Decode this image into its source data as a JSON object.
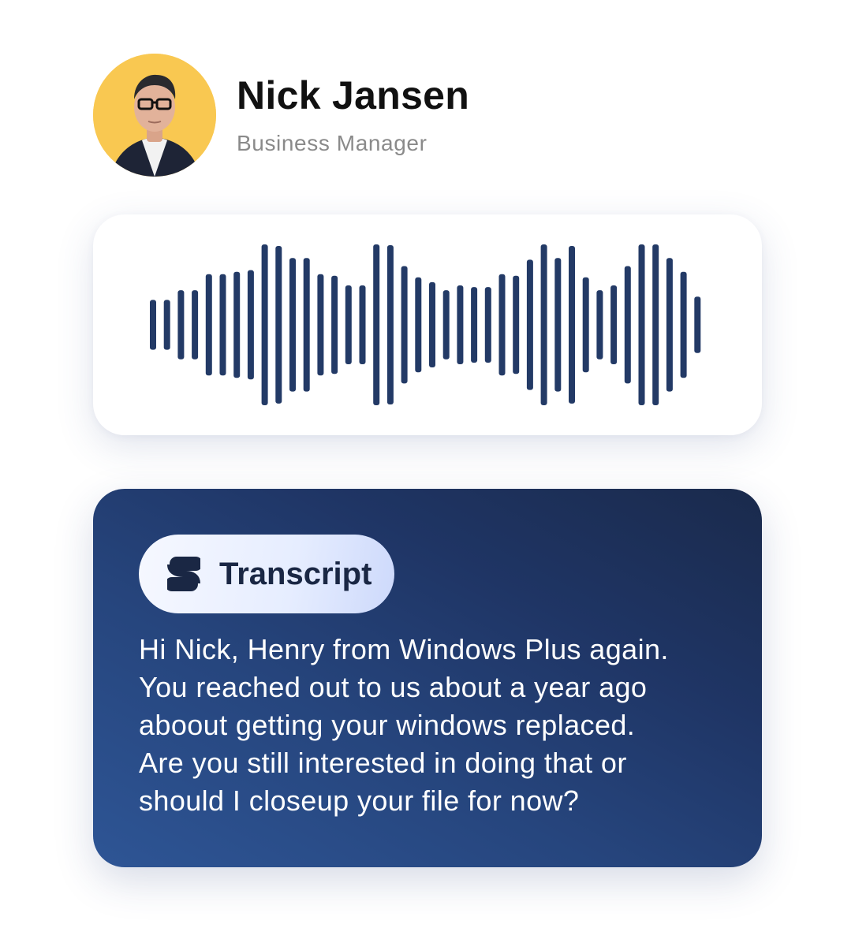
{
  "profile": {
    "name": "Nick Jansen",
    "role": "Business Manager",
    "avatar_background": "#f9c851"
  },
  "waveform": {
    "color": "#233a66",
    "levels": [
      0.31,
      0.31,
      0.43,
      0.43,
      0.63,
      0.63,
      0.66,
      0.68,
      1.0,
      0.98,
      0.83,
      0.83,
      0.63,
      0.61,
      0.49,
      0.49,
      1.0,
      0.99,
      0.73,
      0.59,
      0.53,
      0.43,
      0.49,
      0.47,
      0.47,
      0.63,
      0.61,
      0.81,
      1.0,
      0.83,
      0.98,
      0.59,
      0.43,
      0.49,
      0.73,
      1.0,
      1.0,
      0.83,
      0.66,
      0.35
    ]
  },
  "transcript": {
    "label": "Transcript",
    "icon": "transcript-logo-icon",
    "lines": [
      "Hi Nick, Henry from Windows Plus again.",
      "You reached out to us about a year ago",
      "aboout getting your windows replaced.",
      "Are you still interested in doing that or",
      "should I closeup your file for now?"
    ]
  },
  "colors": {
    "accent_navy": "#1a2744",
    "card_gradient_start": "#2e5595",
    "card_gradient_end": "#1a2a4c"
  }
}
